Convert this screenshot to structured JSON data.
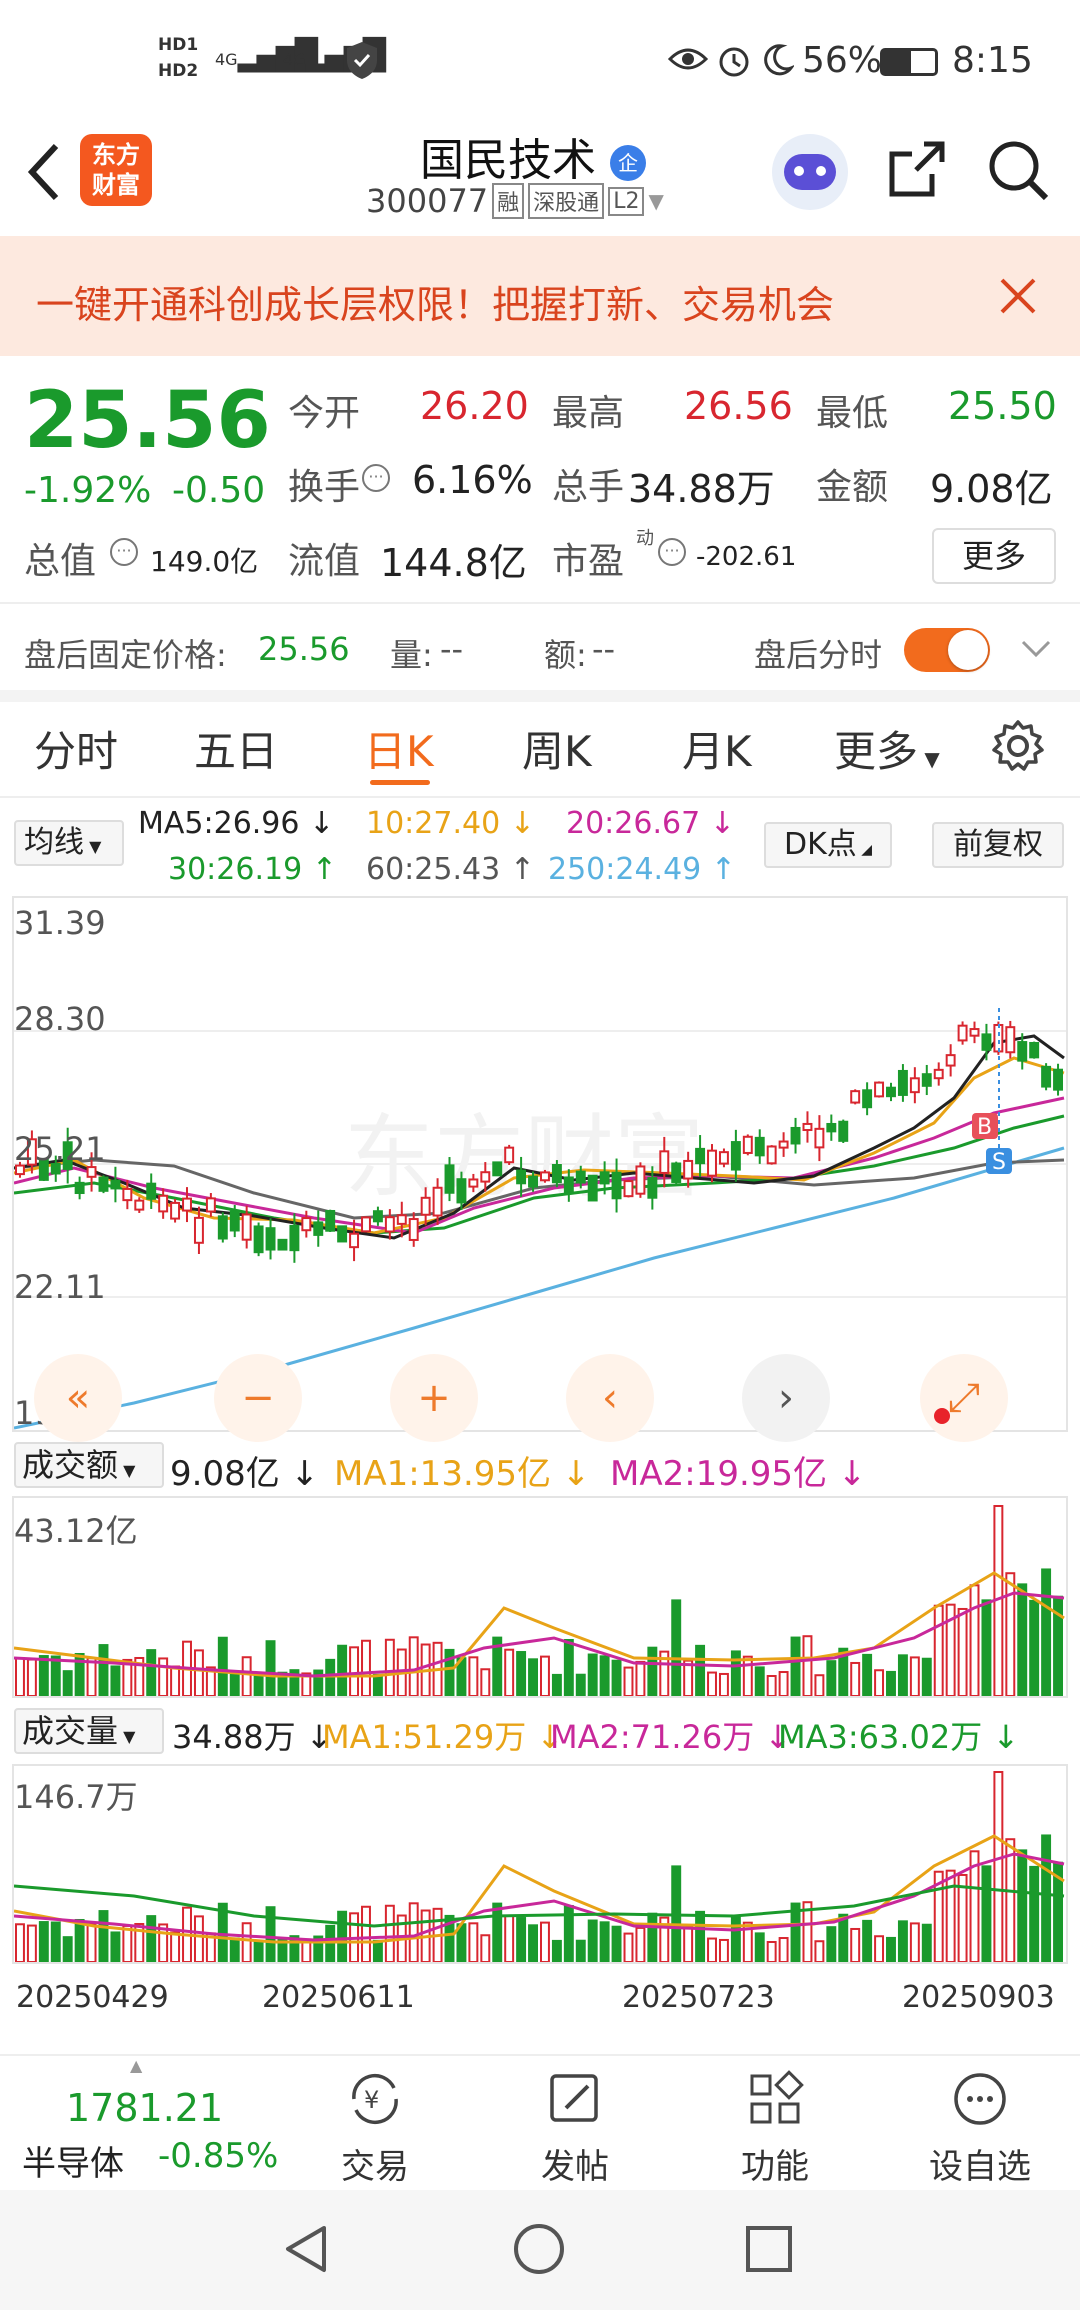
{
  "status_bar": {
    "hd1": "HD1",
    "hd2": "HD2",
    "net1": "4G",
    "net2": "4G",
    "battery": "56%",
    "time": "8:15"
  },
  "header": {
    "logo_line1": "东方",
    "logo_line2": "财富",
    "title": "国民技术",
    "badge": "企",
    "code": "300077",
    "tag_rong": "融",
    "tag_sgt": "深股通",
    "tag_l2": "L2"
  },
  "banner": {
    "text": "一键开通科创成长层权限！把握打新、交易机会"
  },
  "quote": {
    "price": "25.56",
    "change_pct": "-1.92%",
    "change": "-0.50",
    "open_label": "今开",
    "open": "26.20",
    "high_label": "最高",
    "high": "26.56",
    "low_label": "最低",
    "low": "25.50",
    "turnover_label": "换手",
    "turnover": "6.16%",
    "volume_label": "总手",
    "volume": "34.88万",
    "amount_label": "金额",
    "amount": "9.08亿",
    "mktcap_label": "总值",
    "mktcap": "149.0亿",
    "float_label": "流值",
    "float": "144.8亿",
    "pe_label": "市盈",
    "pe_sup": "动",
    "pe": "-202.61",
    "more": "更多"
  },
  "after_hours": {
    "price_label": "盘后固定价格:",
    "price": "25.56",
    "vol_label": "量:",
    "vol": "--",
    "amt_label": "额:",
    "amt": "--",
    "fenshi_label": "盘后分时"
  },
  "tabs": [
    "分时",
    "五日",
    "日K",
    "周K",
    "月K",
    "更多"
  ],
  "ma_bar": {
    "selector": "均线",
    "ma5": "MA5:26.96",
    "ma10": "10:27.40",
    "ma20": "20:26.67",
    "ma30": "30:26.19",
    "ma60": "60:25.43",
    "ma250": "250:24.49",
    "dk": "DK点",
    "fq": "前复权"
  },
  "kline": {
    "y_labels": [
      "31.39",
      "28.30",
      "25.21",
      "22.11",
      "19.02"
    ],
    "buy_marker": "B",
    "sell_marker": "S"
  },
  "amount_panel": {
    "selector": "成交额",
    "value": "9.08亿",
    "ma1": "MA1:13.95亿",
    "ma2": "MA2:19.95亿",
    "max": "43.12亿"
  },
  "volume_panel": {
    "selector": "成交量",
    "value": "34.88万",
    "ma1": "MA1:51.29万",
    "ma2": "MA2:71.26万",
    "ma3": "MA3:63.02万",
    "max": "146.7万"
  },
  "dates": [
    "20250429",
    "20250611",
    "20250723",
    "20250903"
  ],
  "bottom_bar": {
    "index_value": "1781.21",
    "index_name": "半导体",
    "index_change": "-0.85%",
    "items": [
      "交易",
      "发帖",
      "功能",
      "设自选"
    ]
  },
  "colors": {
    "up": "#d8262f",
    "down": "#1a9a2c",
    "accent": "#f26b1d",
    "ma5": "#222222",
    "ma10": "#e8a317",
    "ma20": "#c8289a",
    "ma30": "#1a9a2c",
    "ma60": "#666666",
    "ma250": "#5ab1e0"
  }
}
